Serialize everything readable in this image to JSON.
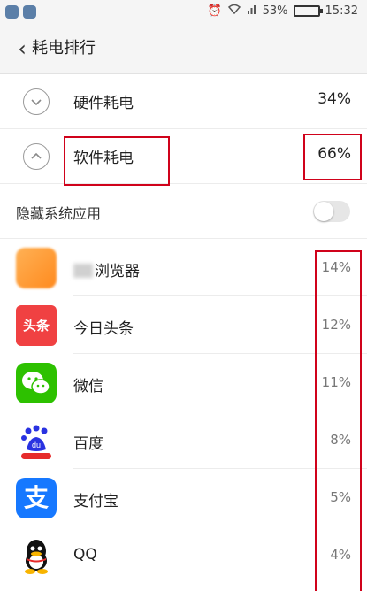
{
  "status_bar": {
    "battery_percent": "53%",
    "time": "15:32",
    "battery_fill_fraction": 0.53
  },
  "header": {
    "back_glyph": "<",
    "title": "耗电排行"
  },
  "summary": [
    {
      "label": "硬件耗电",
      "value": "34%",
      "expander": "chevron-down"
    },
    {
      "label": "软件耗电",
      "value": "66%",
      "expander": "chevron-up"
    }
  ],
  "hide_system": {
    "label": "隐藏系统应用",
    "enabled": false
  },
  "apps": [
    {
      "name": "浏览器",
      "value": "14%",
      "icon": "browser-icon"
    },
    {
      "name": "今日头条",
      "value": "12%",
      "icon": "toutiao-icon",
      "icon_text": "头条"
    },
    {
      "name": "微信",
      "value": "11%",
      "icon": "wechat-icon"
    },
    {
      "name": "百度",
      "value": "8%",
      "icon": "baidu-icon",
      "icon_text": "du"
    },
    {
      "name": "支付宝",
      "value": "5%",
      "icon": "alipay-icon",
      "icon_text": "支"
    },
    {
      "name": "QQ",
      "value": "4%",
      "icon": "qq-icon"
    }
  ],
  "colors": {
    "highlight_box": "#d0021b",
    "toutiao_red": "#f04142",
    "wechat_green": "#2dc100",
    "alipay_blue": "#1678ff",
    "battery_green": "#3bb34a"
  }
}
